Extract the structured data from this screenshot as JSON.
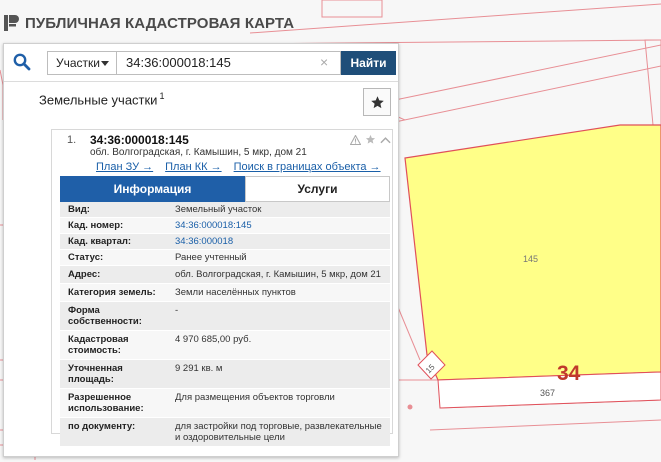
{
  "brand": {
    "title": "ПУБЛИЧНАЯ КАДАСТРОВАЯ КАРТА"
  },
  "search": {
    "type_label": "Участки",
    "query": "34:36:000018:145",
    "clear_glyph": "×",
    "find_label": "Найти"
  },
  "results": {
    "title": "Земельные участки",
    "count": "1"
  },
  "parcel": {
    "index": "1.",
    "number": "34:36:000018:145",
    "address": "обл. Волгоградская, г. Камышин, 5 мкр, дом 21",
    "links": [
      "План ЗУ →",
      "План КК →",
      "Поиск в границах объекта →"
    ]
  },
  "tabs": {
    "info": "Информация",
    "services": "Услуги"
  },
  "attributes": [
    {
      "label": "Вид:",
      "value": "Земельный участок"
    },
    {
      "label": "Кад. номер:",
      "value": "34:36:000018:145",
      "link": true
    },
    {
      "label": "Кад. квартал:",
      "value": "34:36:000018",
      "link": true
    },
    {
      "label": "Статус:",
      "value": "Ранее учтенный"
    },
    {
      "label": "Адрес:",
      "value": "обл. Волгоградская, г. Камышин, 5 мкр, дом 21"
    },
    {
      "label": "Категория земель:",
      "value": "Земли населённых пунктов"
    },
    {
      "label": "Форма собственности:",
      "value": "-"
    },
    {
      "label": "Кадастровая стоимость:",
      "value": "4 970 685,00 руб."
    },
    {
      "label": "Уточненная площадь:",
      "value": "9 291 кв. м"
    },
    {
      "label": "Разрешенное использование:",
      "value": "Для размещения объектов торговли"
    },
    {
      "label": "по документу:",
      "value": "для застройки под торговые, развлекательные и оздоровительные цели"
    }
  ],
  "map": {
    "parcel_label": "145",
    "quarter_label": "34",
    "neighbor_label": "367",
    "corner_label": "15"
  },
  "colors": {
    "parcel_fill": "#ffff88",
    "parcel_stroke": "#e0505a",
    "quarter_label": "#c0392b",
    "accent": "#1f4e79",
    "tab_active": "#1f5fa8"
  }
}
